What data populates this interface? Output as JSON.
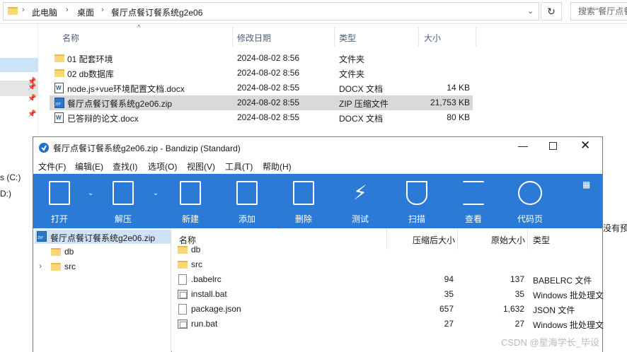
{
  "explorer": {
    "breadcrumb": [
      "此电脑",
      "桌面",
      "餐厅点餐订餐系统g2e06"
    ],
    "search_placeholder": "搜索\"餐厅点餐",
    "columns": {
      "name": "名称",
      "date": "修改日期",
      "type": "类型",
      "size": "大小"
    },
    "files": [
      {
        "name": "01 配套环境",
        "date": "2024-08-02 8:56",
        "type": "文件夹",
        "size": "",
        "icon": "folder-icon"
      },
      {
        "name": "02 db数据库",
        "date": "2024-08-02 8:56",
        "type": "文件夹",
        "size": "",
        "icon": "folder-icon"
      },
      {
        "name": "node.js+vue环境配置文档.docx",
        "date": "2024-08-02 8:55",
        "type": "DOCX 文档",
        "size": "14 KB",
        "icon": "word-doc-icon"
      },
      {
        "name": "餐厅点餐订餐系统g2e06.zip",
        "date": "2024-08-02 8:55",
        "type": "ZIP 压缩文件",
        "size": "21,753 KB",
        "icon": "zip-icon"
      },
      {
        "name": "已答辩的论文.docx",
        "date": "2024-08-02 8:55",
        "type": "DOCX 文档",
        "size": "80 KB",
        "icon": "word-doc-icon"
      }
    ],
    "drives": [
      "s (C:)",
      "D:)"
    ],
    "right_cutoff_text": "没有预"
  },
  "bandizip": {
    "title": "餐厅点餐订餐系统g2e06.zip - Bandizip (Standard)",
    "menu": [
      "文件(F)",
      "编辑(E)",
      "查找(I)",
      "选项(O)",
      "视图(V)",
      "工具(T)",
      "帮助(H)"
    ],
    "toolbar": [
      {
        "label": "打开",
        "icon": "open-icon"
      },
      {
        "label": "解压",
        "icon": "extract-icon"
      },
      {
        "label": "新建",
        "icon": "new-archive-icon"
      },
      {
        "label": "添加",
        "icon": "add-file-icon"
      },
      {
        "label": "删除",
        "icon": "delete-file-icon"
      },
      {
        "label": "测试",
        "icon": "test-lightning-icon"
      },
      {
        "label": "扫描",
        "icon": "scan-shield-icon"
      },
      {
        "label": "查看",
        "icon": "view-list-icon"
      },
      {
        "label": "代码页",
        "icon": "codepage-globe-icon"
      }
    ],
    "tree": {
      "root": "餐厅点餐订餐系统g2e06.zip",
      "children": [
        "db",
        "src"
      ]
    },
    "columns": {
      "name": "名称",
      "packed": "压缩后大小",
      "original": "原始大小",
      "type": "类型"
    },
    "files": [
      {
        "name": "db",
        "packed": "",
        "original": "",
        "type": ""
      },
      {
        "name": "src",
        "packed": "",
        "original": "",
        "type": ""
      },
      {
        "name": ".babelrc",
        "packed": "94",
        "original": "137",
        "type": "BABELRC 文件"
      },
      {
        "name": "install.bat",
        "packed": "35",
        "original": "35",
        "type": "Windows 批处理文"
      },
      {
        "name": "package.json",
        "packed": "657",
        "original": "1,632",
        "type": "JSON 文件"
      },
      {
        "name": "run.bat",
        "packed": "27",
        "original": "27",
        "type": "Windows 批处理文"
      }
    ]
  },
  "watermark": "CSDN @星海学长_毕设"
}
